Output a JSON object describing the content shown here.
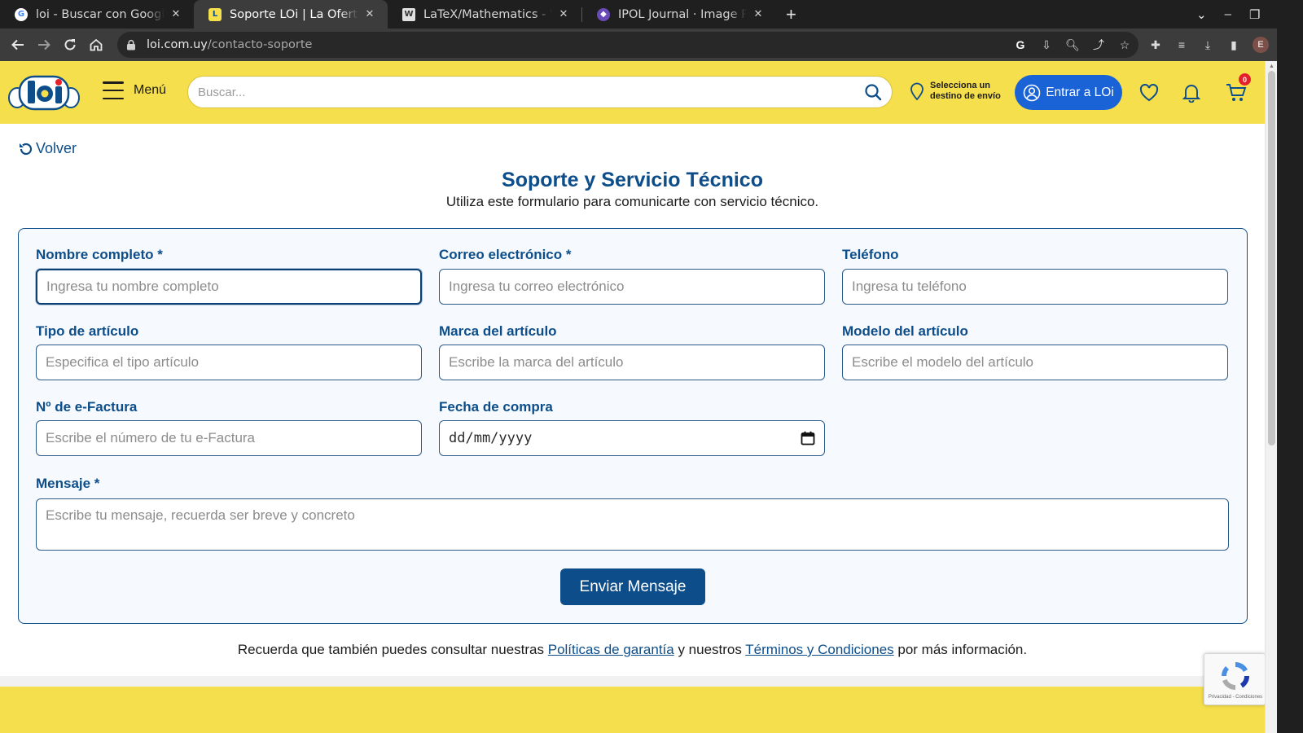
{
  "browser": {
    "tabs": [
      {
        "title": "loi - Buscar con Google",
        "active": false
      },
      {
        "title": "Soporte LOi | La Oferta Irr",
        "active": true
      },
      {
        "title": "LaTeX/Mathematics - Wik",
        "active": false
      },
      {
        "title": "IPOL Journal · Image Proc",
        "active": false
      }
    ],
    "url_host": "loi.com.uy",
    "url_path": "/contacto-soporte",
    "profile_initial": "E"
  },
  "header": {
    "menu_label": "Menú",
    "search_placeholder": "Buscar...",
    "destination_text": "Selecciona un destino de envío",
    "login_label": "Entrar a LOi",
    "cart_count": "0",
    "brand_yellow": "#f6df4c",
    "brand_blue": "#0d4e8a"
  },
  "page": {
    "back_label": "Volver",
    "title": "Soporte y Servicio Técnico",
    "subtitle": "Utiliza este formulario para comunicarte con servicio técnico."
  },
  "form": {
    "name": {
      "label": "Nombre completo *",
      "placeholder": "Ingresa tu nombre completo"
    },
    "email": {
      "label": "Correo electrónico *",
      "placeholder": "Ingresa tu correo electrónico"
    },
    "phone": {
      "label": "Teléfono",
      "placeholder": "Ingresa tu teléfono"
    },
    "item_type": {
      "label": "Tipo de artículo",
      "placeholder": "Especifica el tipo artículo"
    },
    "item_brand": {
      "label": "Marca del artículo",
      "placeholder": "Escribe la marca del artículo"
    },
    "item_model": {
      "label": "Modelo del artículo",
      "placeholder": "Escribe el modelo del artículo"
    },
    "invoice": {
      "label": "Nº de e-Factura",
      "placeholder": "Escribe el número de tu e-Factura"
    },
    "purchase_date": {
      "label": "Fecha de compra",
      "value": "dd/mm/yyyy"
    },
    "message": {
      "label": "Mensaje *",
      "placeholder": "Escribe tu mensaje, recuerda ser breve y concreto"
    },
    "submit_label": "Enviar Mensaje"
  },
  "footer_note": {
    "before": "Recuerda que también puedes consultar nuestras ",
    "link1": "Políticas de garantía",
    "middle": " y nuestros ",
    "link2": "Términos y Condiciones",
    "after": " por más información."
  },
  "recaptcha": {
    "text": "Privacidad - Condiciones"
  }
}
